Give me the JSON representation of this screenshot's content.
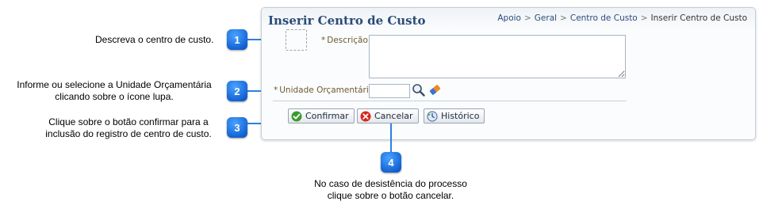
{
  "panel": {
    "title": "Inserir Centro de Custo",
    "breadcrumb": [
      "Apoio",
      "Geral",
      "Centro de Custo"
    ],
    "breadcrumb_current": "Inserir Centro de Custo",
    "breadcrumb_separator": ">"
  },
  "form": {
    "descricao_label": "Descrição",
    "descricao_value": "",
    "unidade_label": "Unidade Orçamentária",
    "unidade_value": "",
    "required_marker": "*"
  },
  "buttons": {
    "confirmar": "Confirmar",
    "cancelar": "Cancelar",
    "historico": "Histórico"
  },
  "callouts": [
    {
      "number": "1",
      "lines": [
        "Descreva o centro de custo."
      ]
    },
    {
      "number": "2",
      "lines": [
        "Informe ou selecione a Unidade Orçamentária",
        "clicando sobre o ícone lupa."
      ]
    },
    {
      "number": "3",
      "lines": [
        "Clique sobre o botão confirmar para a",
        "inclusão do registro de centro de custo."
      ]
    },
    {
      "number": "4",
      "lines": [
        "No caso de desistência do processo",
        "clique sobre o botão cancelar."
      ]
    }
  ],
  "colors": {
    "badge": "#1566d6",
    "title": "#2b4b79",
    "label": "#6b5a33"
  },
  "icons": [
    "search-icon",
    "eraser-icon",
    "check-icon",
    "cancel-icon",
    "history-icon"
  ]
}
